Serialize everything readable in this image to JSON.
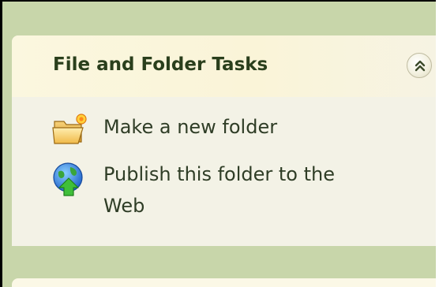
{
  "panel": {
    "title": "File and Folder Tasks",
    "collapse_icon": "chevron-double-up-icon"
  },
  "tasks": [
    {
      "label": "Make a new folder",
      "icon": "new-folder-icon"
    },
    {
      "label_line1": "Publish this folder to the",
      "label_line2": "Web",
      "icon": "publish-web-icon"
    }
  ],
  "colors": {
    "background": "#c8d6aa",
    "panel": "#f3f2e6",
    "header": "#faf4d8",
    "title_text": "#2a3f1c",
    "task_text": "#2f3d26"
  }
}
